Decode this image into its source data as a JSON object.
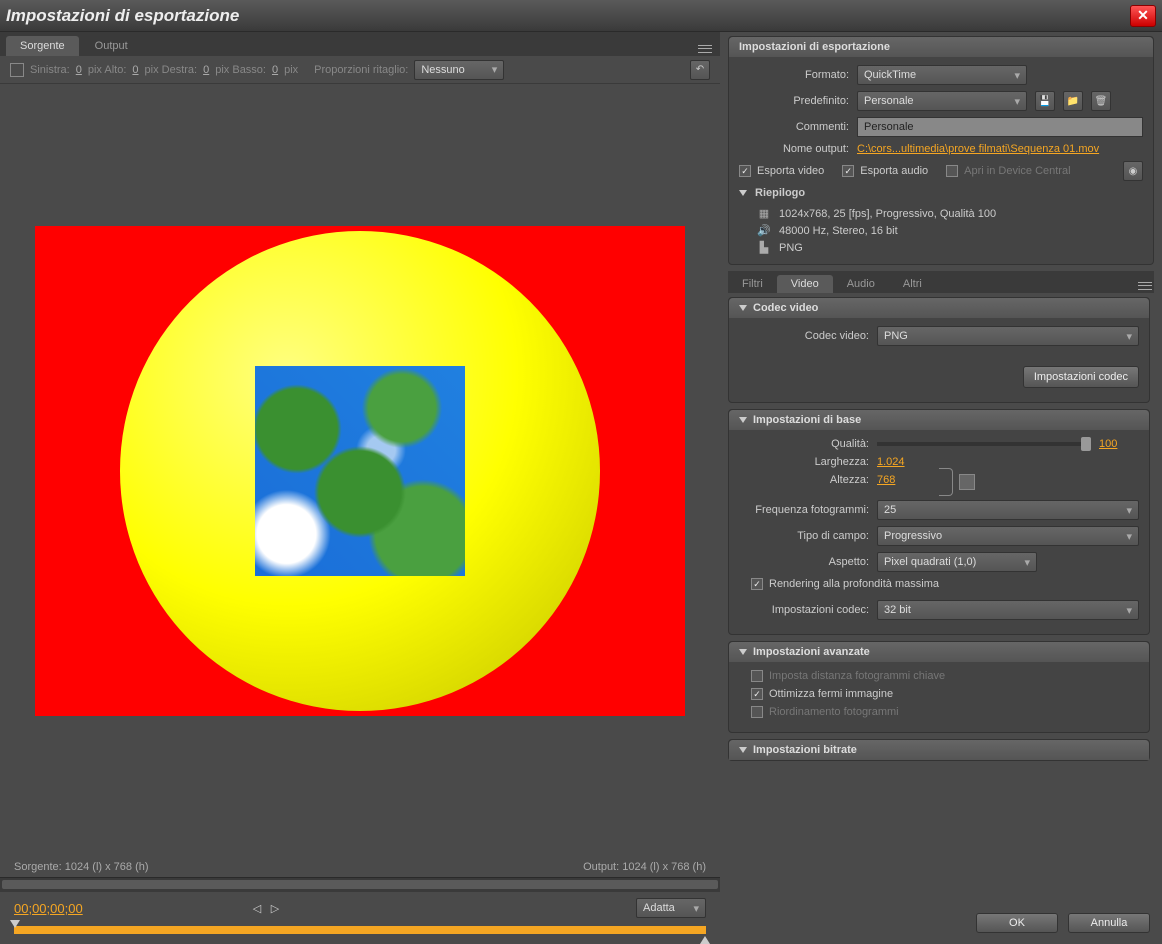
{
  "window": {
    "title": "Impostazioni di esportazione"
  },
  "left_tabs": {
    "source": "Sorgente",
    "output": "Output"
  },
  "crop": {
    "left_lbl": "Sinistra:",
    "left_val": "0",
    "top_lbl": "pix Alto:",
    "top_val": "0",
    "right_lbl": "pix Destra:",
    "right_val": "0",
    "bottom_lbl": "pix Basso:",
    "bottom_val": "0",
    "px": "pix",
    "ratio_lbl": "Proporzioni ritaglio:",
    "ratio_val": "Nessuno"
  },
  "preview": {
    "source_info": "Sorgente: 1024 (l) x 768 (h)",
    "output_info": "Output: 1024 (l) x 768 (h)"
  },
  "timeline": {
    "timecode": "00;00;00;00",
    "fit": "Adatta"
  },
  "export": {
    "header": "Impostazioni di esportazione",
    "format_lbl": "Formato:",
    "format_val": "QuickTime",
    "preset_lbl": "Predefinito:",
    "preset_val": "Personale",
    "comments_lbl": "Commenti:",
    "comments_val": "Personale",
    "output_lbl": "Nome output:",
    "output_path": "C:\\cors...ultimedia\\prove filmati\\Sequenza 01.mov",
    "export_video": "Esporta video",
    "export_audio": "Esporta audio",
    "device_central": "Apri in Device Central",
    "summary_lbl": "Riepilogo",
    "summary_video": "1024x768, 25 [fps], Progressivo, Qualità 100",
    "summary_audio": "48000 Hz, Stereo, 16 bit",
    "summary_codec": "PNG"
  },
  "sub_tabs": {
    "filters": "Filtri",
    "video": "Video",
    "audio": "Audio",
    "others": "Altri"
  },
  "codec": {
    "header": "Codec video",
    "label": "Codec video:",
    "value": "PNG",
    "settings_btn": "Impostazioni codec"
  },
  "basic": {
    "header": "Impostazioni di base",
    "quality_lbl": "Qualità:",
    "quality_val": "100",
    "width_lbl": "Larghezza:",
    "width_val": "1.024",
    "height_lbl": "Altezza:",
    "height_val": "768",
    "fps_lbl": "Frequenza fotogrammi:",
    "fps_val": "25",
    "field_lbl": "Tipo di campo:",
    "field_val": "Progressivo",
    "aspect_lbl": "Aspetto:",
    "aspect_val": "Pixel quadrati (1,0)",
    "max_depth": "Rendering alla profondità massima",
    "codec_settings_lbl": "Impostazioni codec:",
    "codec_settings_val": "32 bit"
  },
  "advanced": {
    "header": "Impostazioni avanzate",
    "keyframe": "Imposta distanza fotogrammi chiave",
    "optimize": "Ottimizza fermi immagine",
    "reorder": "Riordinamento fotogrammi"
  },
  "bitrate": {
    "header": "Impostazioni bitrate"
  },
  "buttons": {
    "ok": "OK",
    "cancel": "Annulla"
  }
}
